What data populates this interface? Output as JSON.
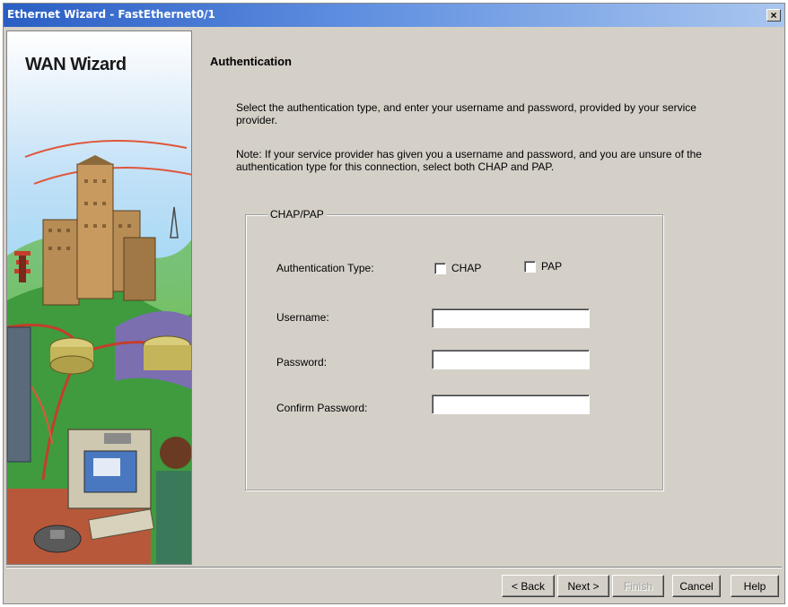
{
  "window": {
    "title": "Ethernet Wizard - FastEthernet0/1",
    "close_label": "×"
  },
  "sidebar": {
    "title": "WAN Wizard"
  },
  "page": {
    "heading": "Authentication",
    "description": "Select the authentication type, and enter your username and password, provided by your service provider.",
    "note": "Note: If your service provider has given you a username and password, and you are unsure of the authentication type for this connection, select both CHAP and PAP."
  },
  "group": {
    "legend": "CHAP/PAP",
    "auth_type_label": "Authentication Type:",
    "chap_label": "CHAP",
    "pap_label": "PAP",
    "chap_checked": false,
    "pap_checked": false,
    "username_label": "Username:",
    "username_value": "",
    "password_label": "Password:",
    "password_value": "",
    "confirm_password_label": "Confirm Password:",
    "confirm_password_value": ""
  },
  "buttons": {
    "back": "< Back",
    "next": "Next >",
    "finish": "Finish",
    "cancel": "Cancel",
    "help": "Help"
  }
}
